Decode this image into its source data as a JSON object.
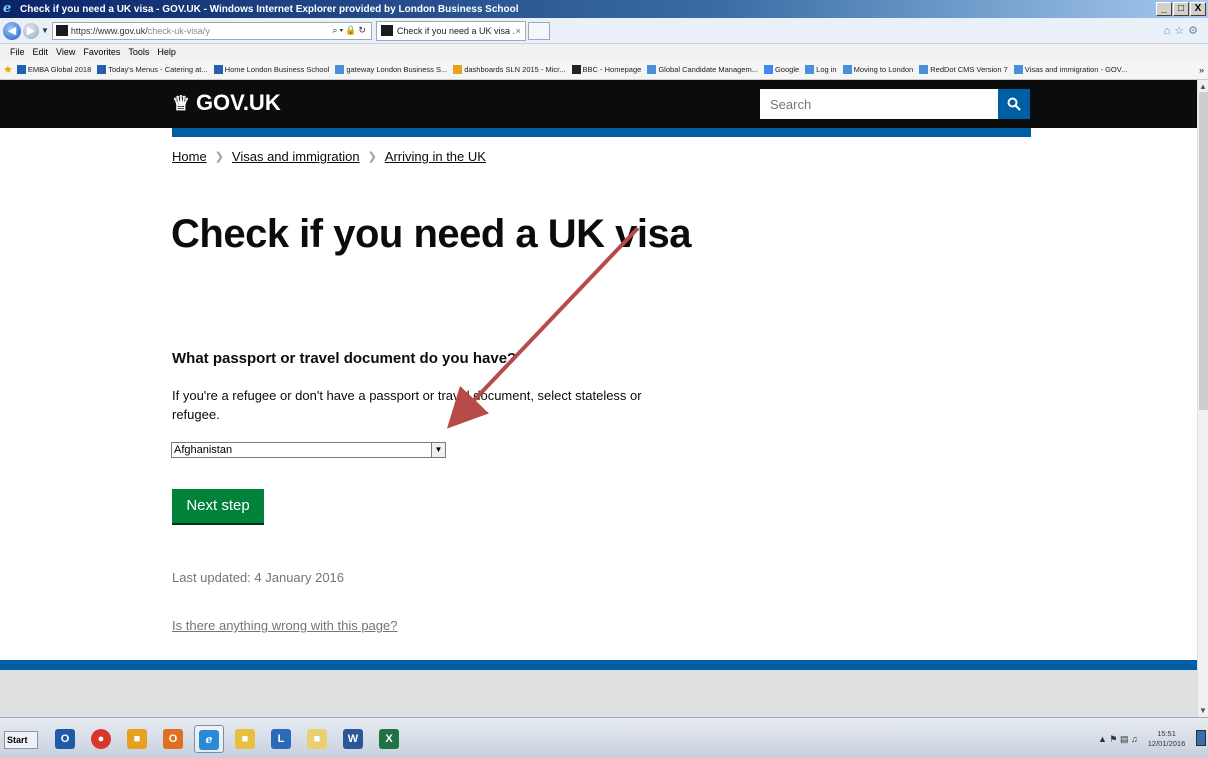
{
  "window": {
    "title": "Check if you need a UK visa - GOV.UK - Windows Internet Explorer provided by London Business School",
    "minimize": "_",
    "maximize": "□",
    "close": "X"
  },
  "address_bar": {
    "url_main": "https://www.gov.uk/",
    "url_rest": "check-uk-visa/y"
  },
  "tab": {
    "label": "Check if you need a UK visa ...",
    "close": "×"
  },
  "menu": [
    "File",
    "Edit",
    "View",
    "Favorites",
    "Tools",
    "Help"
  ],
  "favorites": [
    {
      "label": "EMBA Global 2018",
      "color": "#1f5fb8"
    },
    {
      "label": "Today's Menus - Catering at...",
      "color": "#2a5db0"
    },
    {
      "label": "Home London Business School",
      "color": "#2a5db0"
    },
    {
      "label": "gateway London Business S...",
      "color": "#4a90d9"
    },
    {
      "label": "dashboards SLN 2015 - Micr...",
      "color": "#e8a020"
    },
    {
      "label": "BBC - Homepage",
      "color": "#222222"
    },
    {
      "label": "Global Candidate Managem...",
      "color": "#4a90d9"
    },
    {
      "label": "Google",
      "color": "#4285f4"
    },
    {
      "label": "Log in",
      "color": "#4a90d9"
    },
    {
      "label": "Moving to London",
      "color": "#4a90d9"
    },
    {
      "label": "RedDot CMS Version 7",
      "color": "#4a90d9"
    },
    {
      "label": "Visas and immigration - GOV...",
      "color": "#4a90d9"
    }
  ],
  "govuk": {
    "logo_text": "GOV.UK",
    "search_placeholder": "Search",
    "search_icon": "magnifier-icon"
  },
  "breadcrumb": [
    "Home",
    "Visas and immigration",
    "Arriving in the UK"
  ],
  "page": {
    "title": "Check if you need a UK visa",
    "question": "What passport or travel document do you have?",
    "hint": "If you're a refugee or don't have a passport or travel document, select stateless or refugee.",
    "selected_country": "Afghanistan",
    "next_button": "Next step",
    "last_updated": "Last updated: 4 January 2016",
    "report_link": "Is there anything wrong with this page?"
  },
  "colors": {
    "govuk_black": "#0b0c0c",
    "govuk_blue": "#005ea5",
    "button_green": "#00823b",
    "annotation_arrow": "#b84a4a"
  },
  "taskbar": {
    "start_label": "Start",
    "time": "15:51",
    "date": "12/01/2016"
  }
}
